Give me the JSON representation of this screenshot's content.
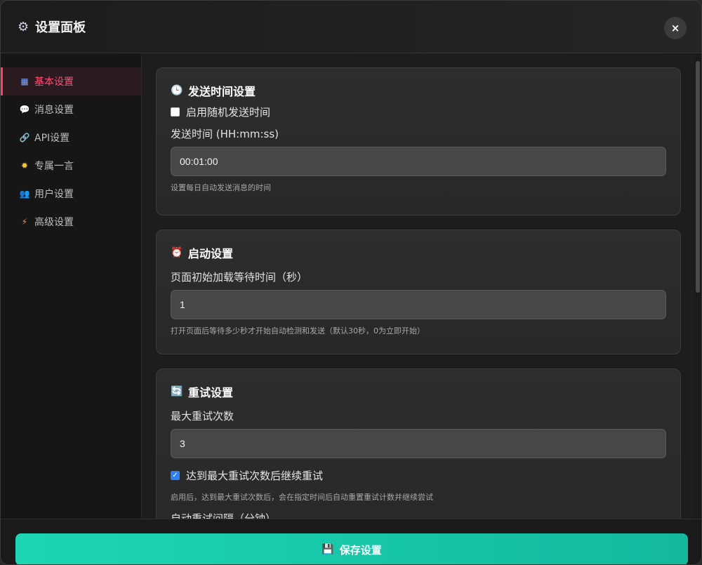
{
  "header": {
    "title": "设置面板",
    "gear_icon": "⚙",
    "close_label": "×"
  },
  "sidebar": {
    "items": [
      {
        "icon": "▦",
        "label": "基本设置",
        "active": true
      },
      {
        "icon": "💬",
        "label": "消息设置"
      },
      {
        "icon": "🔗",
        "label": "API设置"
      },
      {
        "icon": "✹",
        "label": "专属一言"
      },
      {
        "icon": "👥",
        "label": "用户设置"
      },
      {
        "icon": "⚡",
        "label": "高级设置"
      }
    ]
  },
  "sections": {
    "send_time": {
      "icon": "🕒",
      "title": "发送时间设置",
      "random_label": "启用随机发送时间",
      "random_checked": false,
      "time_label": "发送时间 (HH:mm:ss)",
      "time_value": "00:01:00",
      "time_hint": "设置每日自动发送消息的时间"
    },
    "startup": {
      "icon": "⏰",
      "title": "启动设置",
      "wait_label": "页面初始加载等待时间（秒）",
      "wait_value": "1",
      "wait_hint": "打开页面后等待多少秒才开始自动检测和发送（默认30秒，0为立即开始）"
    },
    "retry": {
      "icon": "🔄",
      "title": "重试设置",
      "max_label": "最大重试次数",
      "max_value": "3",
      "continue_label": "达到最大重试次数后继续重试",
      "continue_checked": true,
      "continue_hint": "启用后，达到最大重试次数后，会在指定时间后自动重置重试计数并继续尝试",
      "interval_label": "自动重试间隔（分钟）"
    }
  },
  "footer": {
    "save_icon": "💾",
    "save_label": "保存设置"
  },
  "colors": {
    "accent_active": "#ff4f76",
    "save_button": "#1dd6b4",
    "checkbox_checked": "#2f7ff5"
  }
}
